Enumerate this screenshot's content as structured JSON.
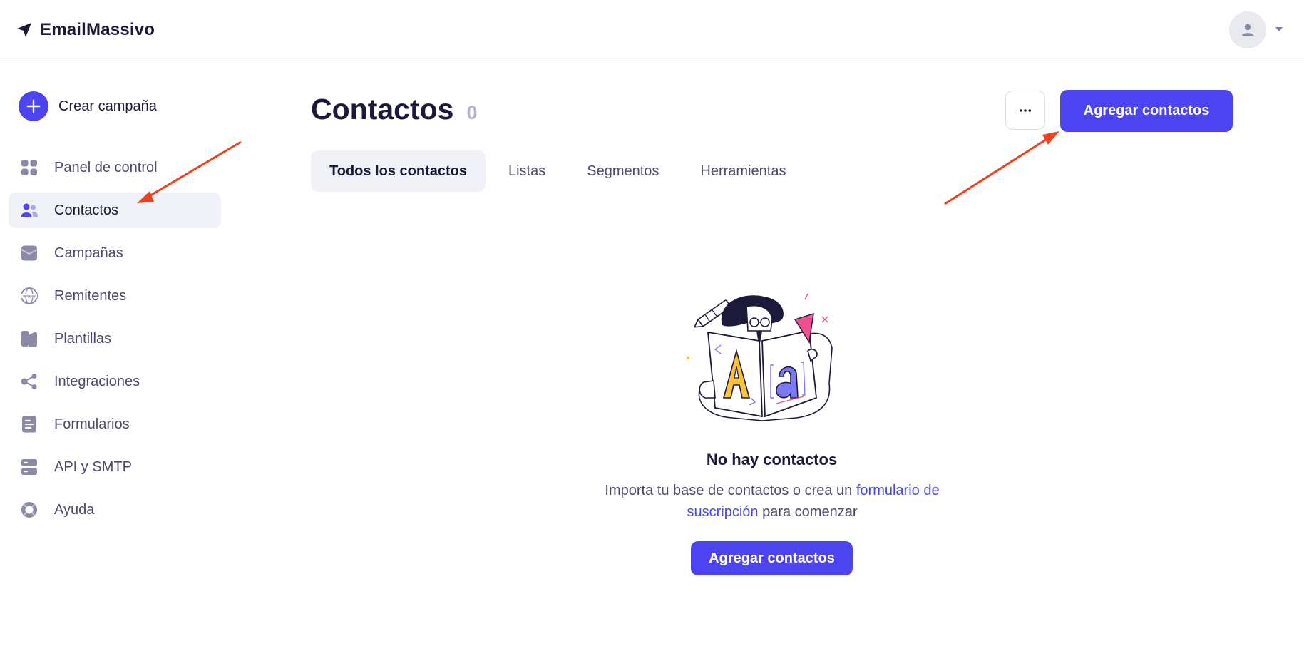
{
  "header": {
    "brand_name": "EmailMassivo",
    "brand_icon": "paper-plane-icon",
    "avatar_icon": "user-icon"
  },
  "sidebar": {
    "create_label": "Crear campaña",
    "items": [
      {
        "label": "Panel de control",
        "icon": "dashboard-icon"
      },
      {
        "label": "Contactos",
        "icon": "contacts-icon",
        "active": true
      },
      {
        "label": "Campañas",
        "icon": "inbox-icon"
      },
      {
        "label": "Remitentes",
        "icon": "globe-www-icon"
      },
      {
        "label": "Plantillas",
        "icon": "templates-icon"
      },
      {
        "label": "Integraciones",
        "icon": "share-nodes-icon"
      },
      {
        "label": "Formularios",
        "icon": "form-icon"
      },
      {
        "label": "API y SMTP",
        "icon": "server-icon"
      },
      {
        "label": "Ayuda",
        "icon": "lifebuoy-icon"
      }
    ]
  },
  "main": {
    "title": "Contactos",
    "count": "0",
    "more_label": "···",
    "add_button_label": "Agregar contactos",
    "tabs": [
      {
        "label": "Todos los contactos",
        "active": true
      },
      {
        "label": "Listas"
      },
      {
        "label": "Segmentos"
      },
      {
        "label": "Herramientas"
      }
    ],
    "empty": {
      "title": "No hay contactos",
      "text_before": "Importa tu base de contactos o crea un ",
      "link": "formulario de suscripción",
      "text_after": " para comenzar",
      "button_label": "Agregar contactos"
    }
  },
  "colors": {
    "accent": "#4b44f0",
    "annotation_arrow": "#f0401f",
    "text_dark": "#1b1a3a",
    "text_muted": "#4a4a6a"
  }
}
